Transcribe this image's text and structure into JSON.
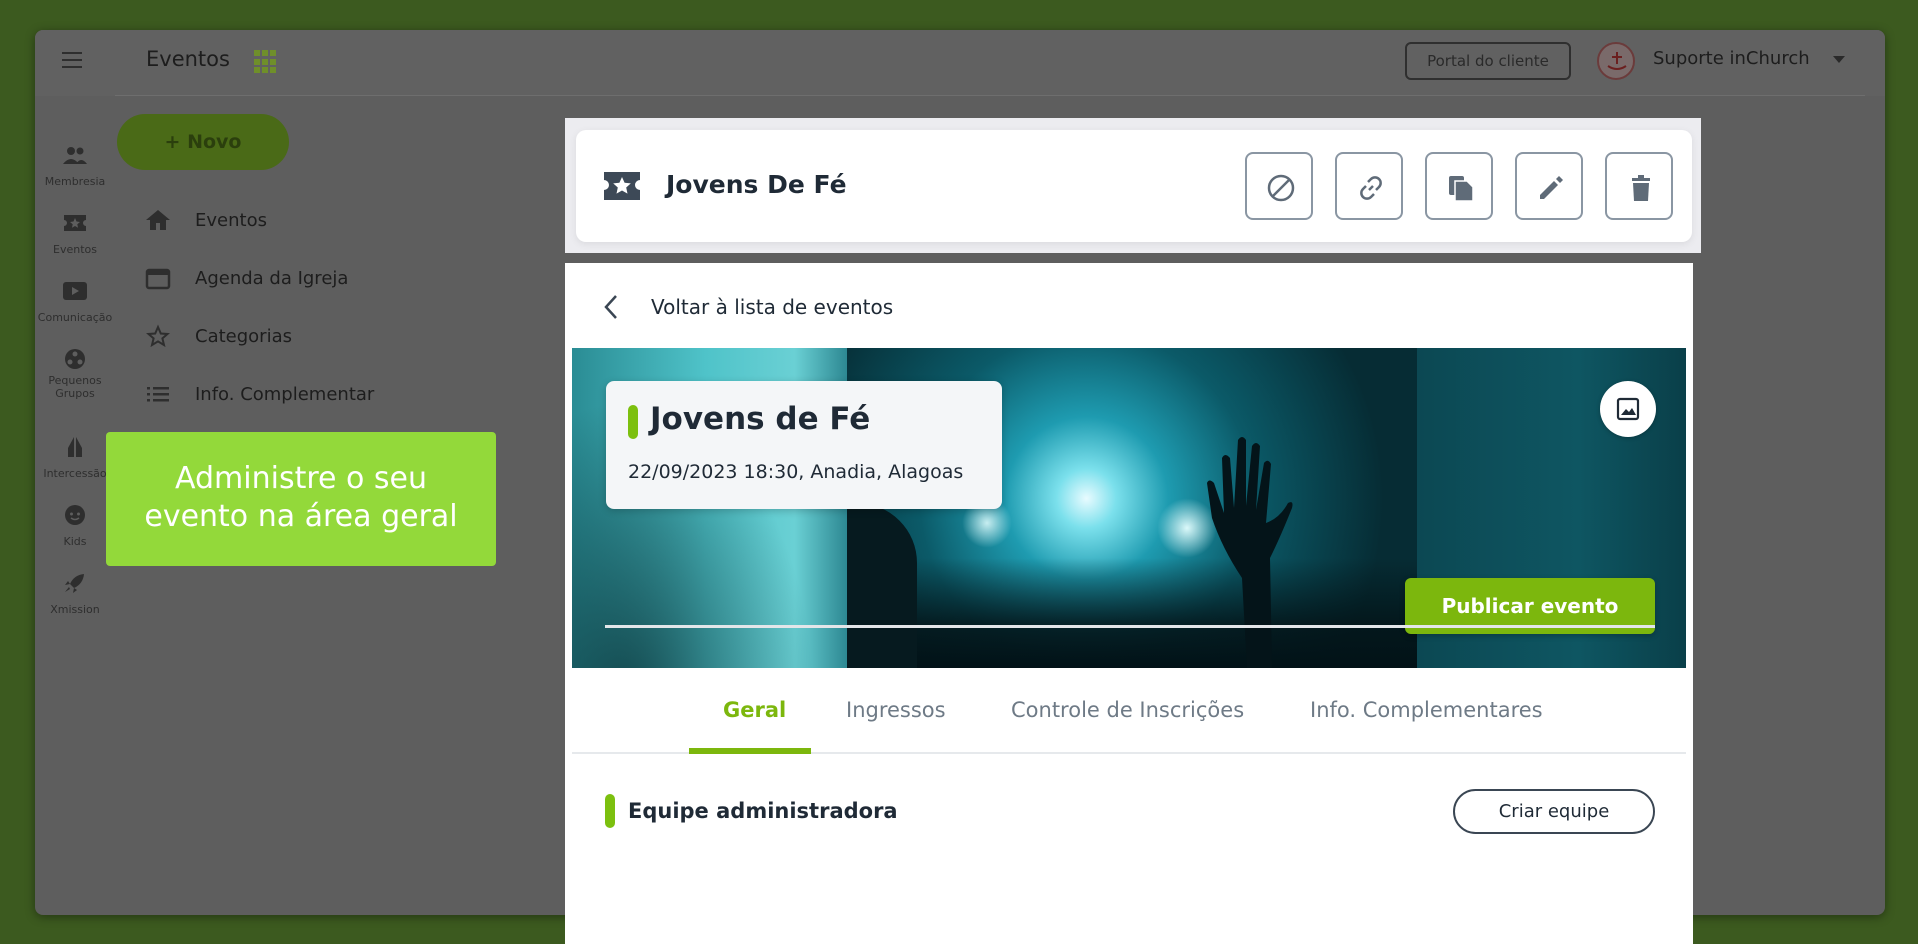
{
  "app": {
    "title": "Eventos",
    "portal_button": "Portal do cliente",
    "org_name": "Suporte inChurch"
  },
  "rail": {
    "items": [
      {
        "label": "Membresia",
        "icon": "members-icon"
      },
      {
        "label": "Eventos",
        "icon": "ticket-icon"
      },
      {
        "label": "Comunicação",
        "icon": "video-icon"
      },
      {
        "label": "Pequenos Grupos",
        "icon": "groups-icon"
      },
      {
        "label": "Intercessão",
        "icon": "praying-hands-icon"
      },
      {
        "label": "Kids",
        "icon": "kid-face-icon"
      },
      {
        "label": "Xmission",
        "icon": "rocket-icon"
      }
    ]
  },
  "sidebar": {
    "new_button": "+ Novo",
    "items": [
      {
        "label": "Eventos",
        "icon": "home-icon"
      },
      {
        "label": "Agenda da Igreja",
        "icon": "calendar-icon"
      },
      {
        "label": "Categorias",
        "icon": "star-icon"
      },
      {
        "label": "Info. Complementar",
        "icon": "list-icon"
      }
    ]
  },
  "tooltip": {
    "line1": "Administre o seu",
    "line2": "evento na área geral"
  },
  "event_header": {
    "name": "Jovens De Fé",
    "actions": [
      "disable-icon",
      "link-icon",
      "copy-icon",
      "edit-icon",
      "delete-icon"
    ]
  },
  "detail": {
    "back_label": "Voltar à lista de eventos",
    "title": "Jovens de Fé",
    "meta": "22/09/2023 18:30, Anadia, Alagoas",
    "publish_button": "Publicar evento",
    "tabs": [
      {
        "label": "Geral",
        "active": true
      },
      {
        "label": "Ingressos",
        "active": false
      },
      {
        "label": "Controle de Inscrições",
        "active": false
      },
      {
        "label": "Info. Complementares",
        "active": false
      }
    ],
    "section_title": "Equipe administradora",
    "create_team_button": "Criar equipe"
  },
  "colors": {
    "accent_green": "#7cb70d",
    "tooltip_green": "#93d93a",
    "text_dark": "#1f2a36",
    "background": "#3c5a1f"
  }
}
